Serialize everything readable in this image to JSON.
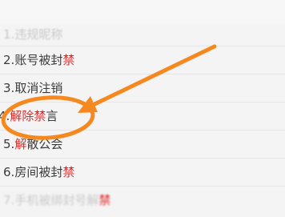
{
  "header": {
    "title": ""
  },
  "rules": [
    {
      "num": "1.",
      "parts": [
        {
          "text": "违规昵称",
          "red": false
        }
      ]
    },
    {
      "num": "2.",
      "parts": [
        {
          "text": "账号被封",
          "red": false
        },
        {
          "text": "禁",
          "red": true
        }
      ]
    },
    {
      "num": "3.",
      "parts": [
        {
          "text": "取消注销",
          "red": false
        }
      ]
    },
    {
      "num": "4.",
      "parts": [
        {
          "text": "解除禁",
          "red": true
        },
        {
          "text": "言",
          "red": false
        }
      ]
    },
    {
      "num": "5.",
      "parts": [
        {
          "text": "解",
          "red": true
        },
        {
          "text": "散公会",
          "red": false
        }
      ]
    },
    {
      "num": "6.",
      "parts": [
        {
          "text": "房间被封",
          "red": false
        },
        {
          "text": "禁",
          "red": true
        }
      ]
    },
    {
      "num": "7.",
      "parts": [
        {
          "text": "手机被绑封号解",
          "red": false
        },
        {
          "text": "禁",
          "red": true
        }
      ]
    }
  ],
  "annotation": {
    "color": "#f5891f",
    "icon": "arrow-circle-highlight"
  }
}
